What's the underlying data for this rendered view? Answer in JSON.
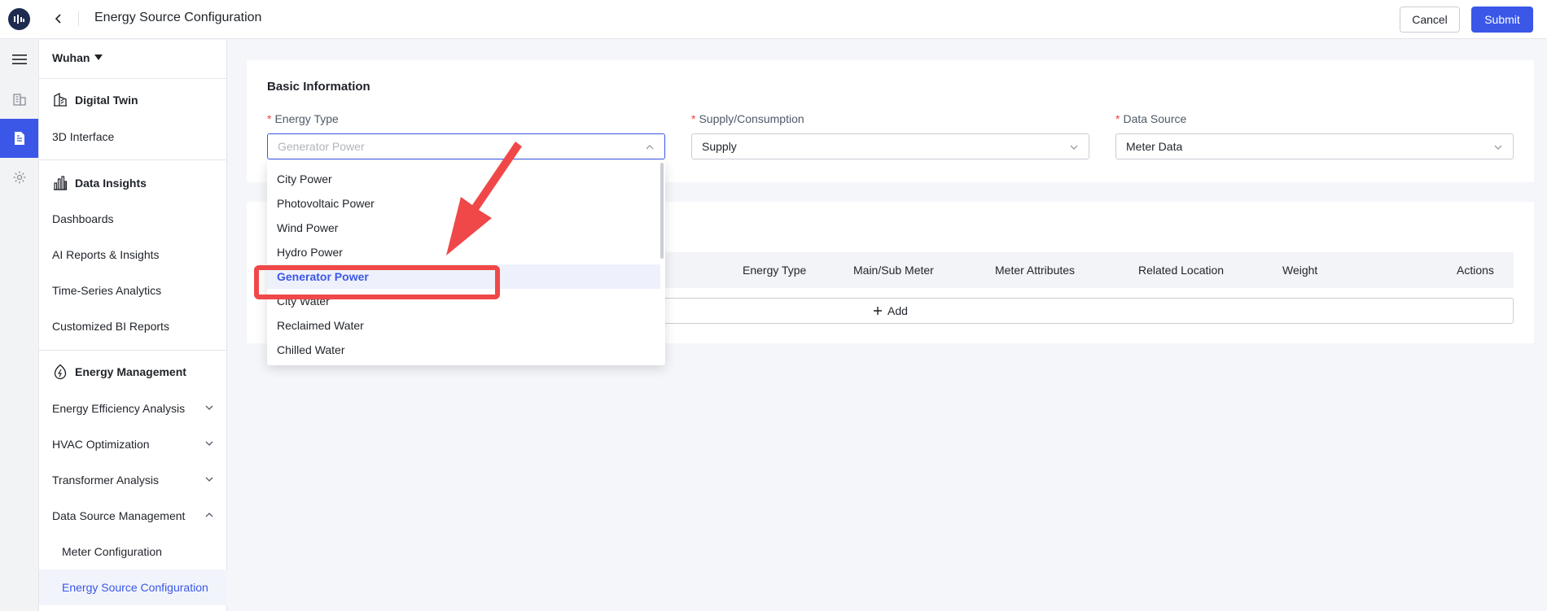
{
  "header": {
    "title": "Energy Source Configuration",
    "cancel_label": "Cancel",
    "submit_label": "Submit"
  },
  "sidebar": {
    "site": "Wuhan",
    "groups": [
      {
        "title": "Digital Twin",
        "items": [
          "3D Interface"
        ]
      },
      {
        "title": "Data Insights",
        "items": [
          "Dashboards",
          "AI Reports & Insights",
          "Time-Series Analytics",
          "Customized BI Reports"
        ]
      },
      {
        "title": "Energy Management",
        "items": [
          "Energy Efficiency Analysis",
          "HVAC Optimization",
          "Transformer Analysis",
          "Data Source Management"
        ]
      }
    ],
    "sub_items": [
      "Meter Configuration",
      "Energy Source Configuration"
    ],
    "selected": "Energy Source Configuration"
  },
  "basic_info": {
    "title": "Basic Information",
    "fields": [
      {
        "label": "Energy Type",
        "value": "Generator Power",
        "required": true
      },
      {
        "label": "Supply/Consumption",
        "value": "Supply",
        "required": true
      },
      {
        "label": "Data Source",
        "value": "Meter Data",
        "required": true
      }
    ]
  },
  "meter_table": {
    "columns": [
      "Energy Type",
      "Main/Sub Meter",
      "Meter Attributes",
      "Related Location",
      "Weight",
      "Actions"
    ],
    "add_label": "Add"
  },
  "dropdown": {
    "options": [
      "City Power",
      "Photovoltaic Power",
      "Wind Power",
      "Hydro Power",
      "Generator Power",
      "City Water",
      "Reclaimed Water",
      "Chilled Water"
    ],
    "selected_index": 4
  },
  "colors": {
    "primary": "#3a57e8",
    "annotation": "#f04848",
    "required": "#f53f3f"
  }
}
